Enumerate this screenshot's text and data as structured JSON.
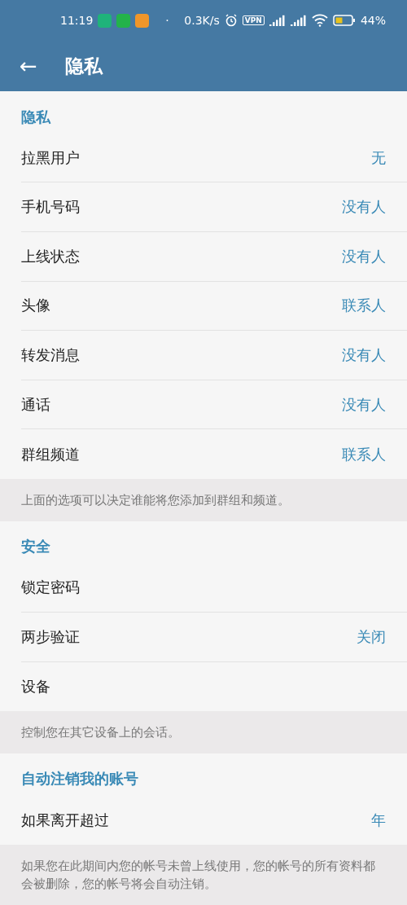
{
  "status_bar": {
    "time": "11:19",
    "dot": "·",
    "speed": "0.3K/s",
    "vpn": "VPN",
    "battery": "44%"
  },
  "header": {
    "back": "←",
    "title": "隐私"
  },
  "sections": [
    {
      "title": "隐私",
      "rows": [
        {
          "label": "拉黑用户",
          "value": "无"
        },
        {
          "label": "手机号码",
          "value": "没有人"
        },
        {
          "label": "上线状态",
          "value": "没有人"
        },
        {
          "label": "头像",
          "value": "联系人"
        },
        {
          "label": "转发消息",
          "value": "没有人"
        },
        {
          "label": "通话",
          "value": "没有人"
        },
        {
          "label": "群组频道",
          "value": "联系人"
        }
      ],
      "note": "上面的选项可以决定谁能将您添加到群组和频道。"
    },
    {
      "title": "安全",
      "rows": [
        {
          "label": "锁定密码"
        },
        {
          "label": "两步验证",
          "value": "关闭"
        },
        {
          "label": "设备"
        }
      ],
      "note": "控制您在其它设备上的会话。"
    },
    {
      "title": "自动注销我的账号",
      "rows": [
        {
          "label": "如果离开超过",
          "value": "年"
        }
      ],
      "note": "如果您在此期间内您的帐号未曾上线使用，您的帐号的所有资料都会被删除，您的帐号将会自动注销。"
    }
  ]
}
